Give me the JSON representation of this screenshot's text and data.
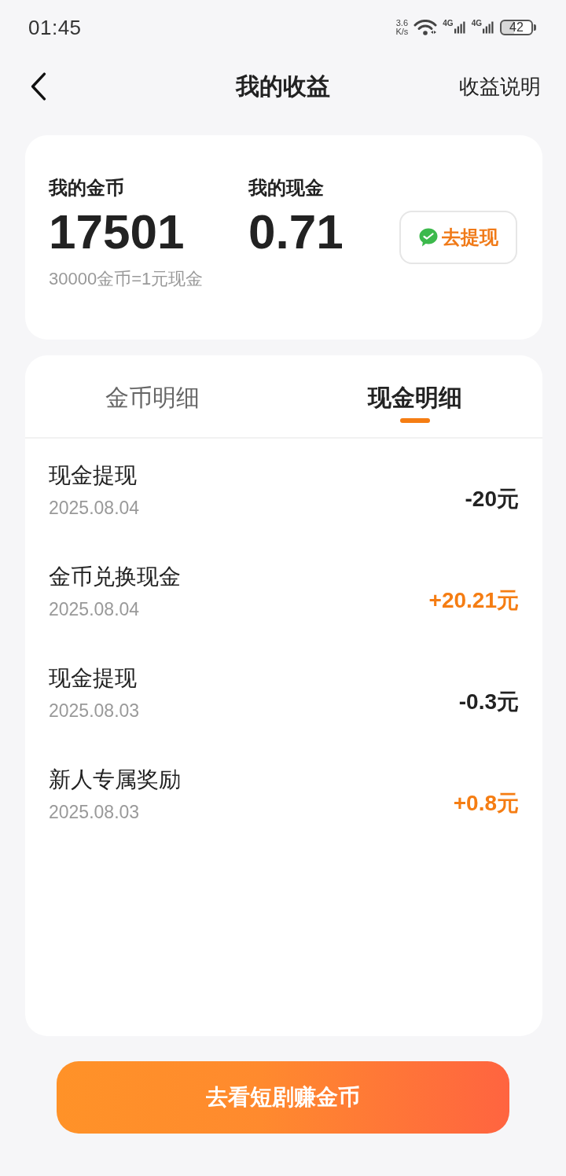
{
  "status_bar": {
    "time": "01:45",
    "net_speed": "3.6",
    "net_speed_unit": "K/s",
    "signals": [
      {
        "label": "4G"
      },
      {
        "label": "4G"
      }
    ],
    "battery": "42"
  },
  "nav": {
    "title": "我的收益",
    "action": "收益说明"
  },
  "summary": {
    "stats": [
      {
        "label": "我的金币",
        "value": "17501"
      },
      {
        "label": "我的现金",
        "value": "0.71"
      }
    ],
    "note": "30000金币=1元现金",
    "withdraw_button": "去提现"
  },
  "tabs": [
    {
      "label": "金币明细",
      "selected": false
    },
    {
      "label": "现金明细",
      "selected": true
    }
  ],
  "records": [
    {
      "title": "现金提现",
      "date": "2025.08.04",
      "amount": "-20元",
      "kind": "debit"
    },
    {
      "title": "金币兑换现金",
      "date": "2025.08.04",
      "amount": "+20.21元",
      "kind": "credit"
    },
    {
      "title": "现金提现",
      "date": "2025.08.03",
      "amount": "-0.3元",
      "kind": "debit"
    },
    {
      "title": "新人专属奖励",
      "date": "2025.08.03",
      "amount": "+0.8元",
      "kind": "credit"
    }
  ],
  "cta_button": "去看短剧赚金币"
}
